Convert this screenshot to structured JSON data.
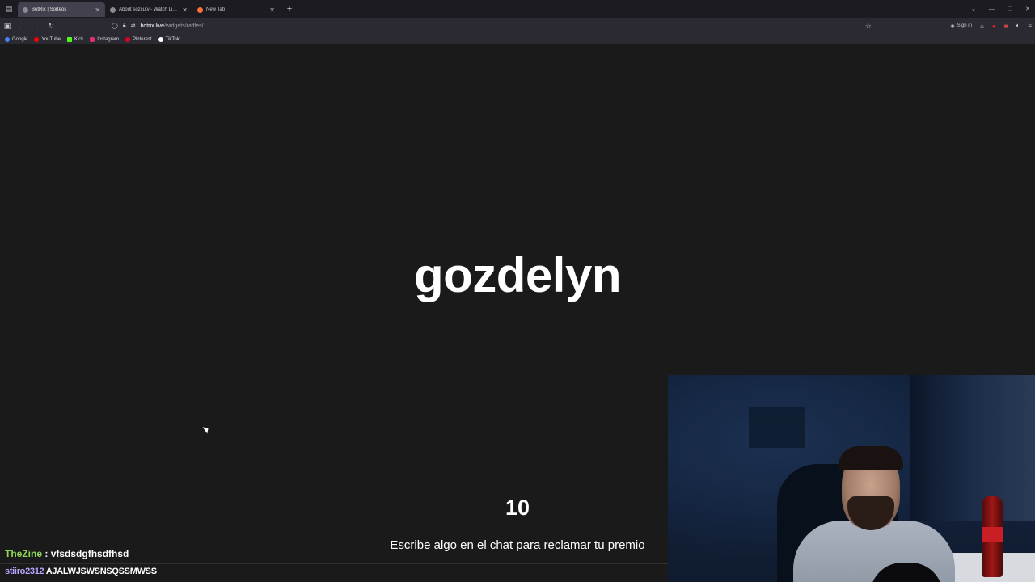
{
  "browser": {
    "tabs": [
      {
        "title": "BotRix | Sorteos",
        "active": true,
        "favicon_color": "#8a8a92"
      },
      {
        "title": "About sozcutv - Watch Live on",
        "active": false,
        "favicon_color": "#8a8a92"
      },
      {
        "title": "New Tab",
        "active": false,
        "favicon_color": "#ff7139"
      }
    ],
    "new_tab_symbol": "+",
    "url": {
      "host": "botrix.live",
      "path": "/widgets/raffles/"
    },
    "sign_in_label": "Sign in",
    "bookmarks": [
      {
        "label": "Google",
        "color": "#4285f4"
      },
      {
        "label": "YouTube",
        "color": "#ff0000"
      },
      {
        "label": "Kick",
        "color": "#53fc18"
      },
      {
        "label": "Instagram",
        "color": "#e1306c"
      },
      {
        "label": "Pinterest",
        "color": "#e60023"
      },
      {
        "label": "TikTok",
        "color": "#ffffff"
      }
    ]
  },
  "raffle": {
    "winner": "gozdelyn",
    "countdown": "10",
    "instruction": "Escribe algo en el chat para reclamar tu premio"
  },
  "chat": [
    {
      "user": "TheZine",
      "separator": " : ",
      "message": "vfsdsdgfhsdfhsd"
    },
    {
      "user": "stiiro2312",
      "message": "AJALWJSWSNSQSSMWSS"
    }
  ],
  "colors": {
    "background": "#1a1a1b",
    "chat_user_green": "#8fd65a",
    "chat_user_purple": "#b9a3ff"
  }
}
